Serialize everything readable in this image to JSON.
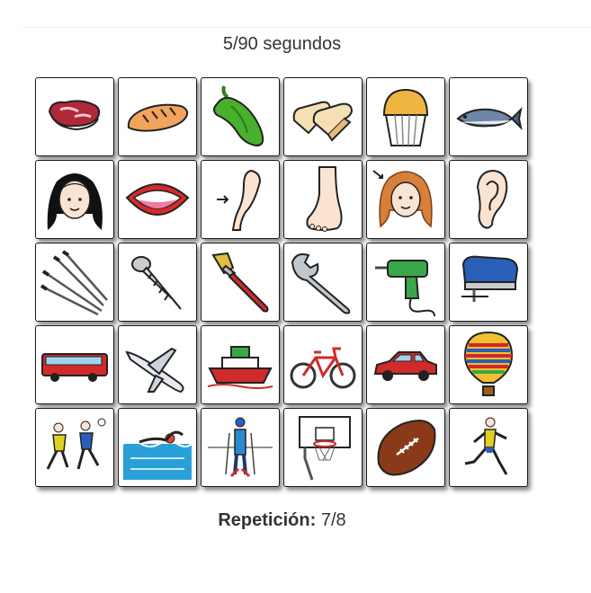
{
  "timer": {
    "text": "5/90 segundos"
  },
  "repetition": {
    "label": "Repetición:",
    "value": "7/8"
  },
  "cards": [
    "meat-steak-icon",
    "bread-loaf-icon",
    "green-pepper-icon",
    "sliced-bread-icon",
    "muffin-icon",
    "tuna-fish-icon",
    "hair-icon",
    "mouth-icon",
    "arm-icon",
    "foot-icon",
    "face-icon",
    "ear-icon",
    "nails-icon",
    "screw-icon",
    "paintbrush-icon",
    "wrench-icon",
    "drill-icon",
    "jigsaw-icon",
    "bus-icon",
    "airplane-icon",
    "ship-icon",
    "bicycle-icon",
    "car-icon",
    "hot-air-balloon-icon",
    "handball-icon",
    "swimmer-icon",
    "skier-icon",
    "basketball-hoop-icon",
    "football-icon",
    "runner-icon"
  ]
}
